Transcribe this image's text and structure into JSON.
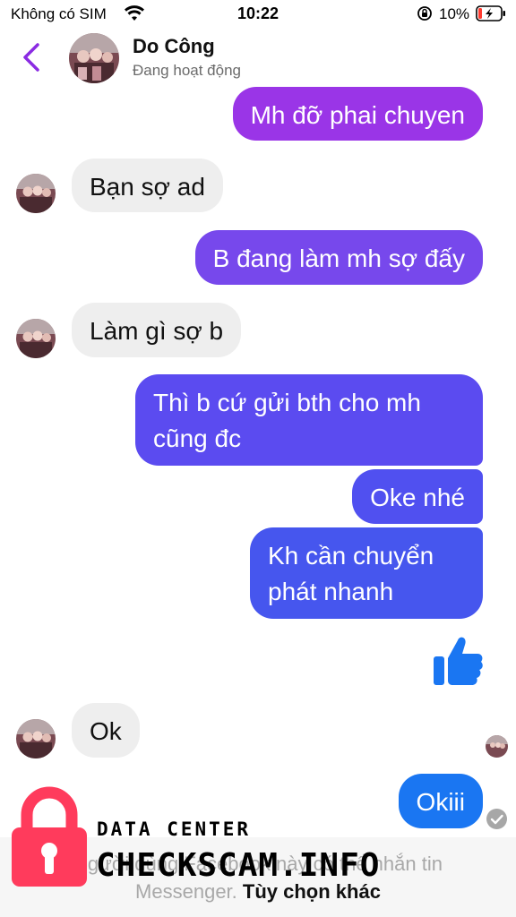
{
  "status_bar": {
    "carrier": "Không có SIM",
    "time": "10:22",
    "battery": "10%"
  },
  "header": {
    "name": "Do Công",
    "status": "Đang hoạt động",
    "accent_color": "#8a2be2"
  },
  "messages": [
    {
      "direction": "out",
      "text": "Mh đỡ phai chuyen"
    },
    {
      "direction": "in",
      "text": "Bạn sợ ad"
    },
    {
      "direction": "out",
      "text": "B đang làm mh sợ đấy"
    },
    {
      "direction": "in",
      "text": "Làm gì sợ b"
    },
    {
      "direction": "out",
      "text": "Thì b cứ gửi bth cho mh cũng đc"
    },
    {
      "direction": "out",
      "text": "Oke nhé"
    },
    {
      "direction": "out",
      "text": "Kh cần chuyển phát nhanh"
    },
    {
      "direction": "out",
      "icon": "thumbs-up-icon"
    },
    {
      "direction": "in",
      "text": "Ok"
    },
    {
      "direction": "out",
      "text": "Okiii"
    }
  ],
  "bottom_notice": {
    "line1": "Người dùng Facebook này có thể nhắn tin",
    "line2_prefix": "Messenger.",
    "line2_link": "Tùy chọn khác"
  },
  "watermark": {
    "label": "DATA CENTER",
    "site": "CHECKSCAM.INFO",
    "color": "#ff3b5c"
  },
  "colors": {
    "incoming_bubble": "#eeeeee",
    "outgoing_gradient_top": "#9a35e7",
    "outgoing_gradient_bottom": "#1a76f2",
    "thumbs_up": "#1a76f2"
  }
}
